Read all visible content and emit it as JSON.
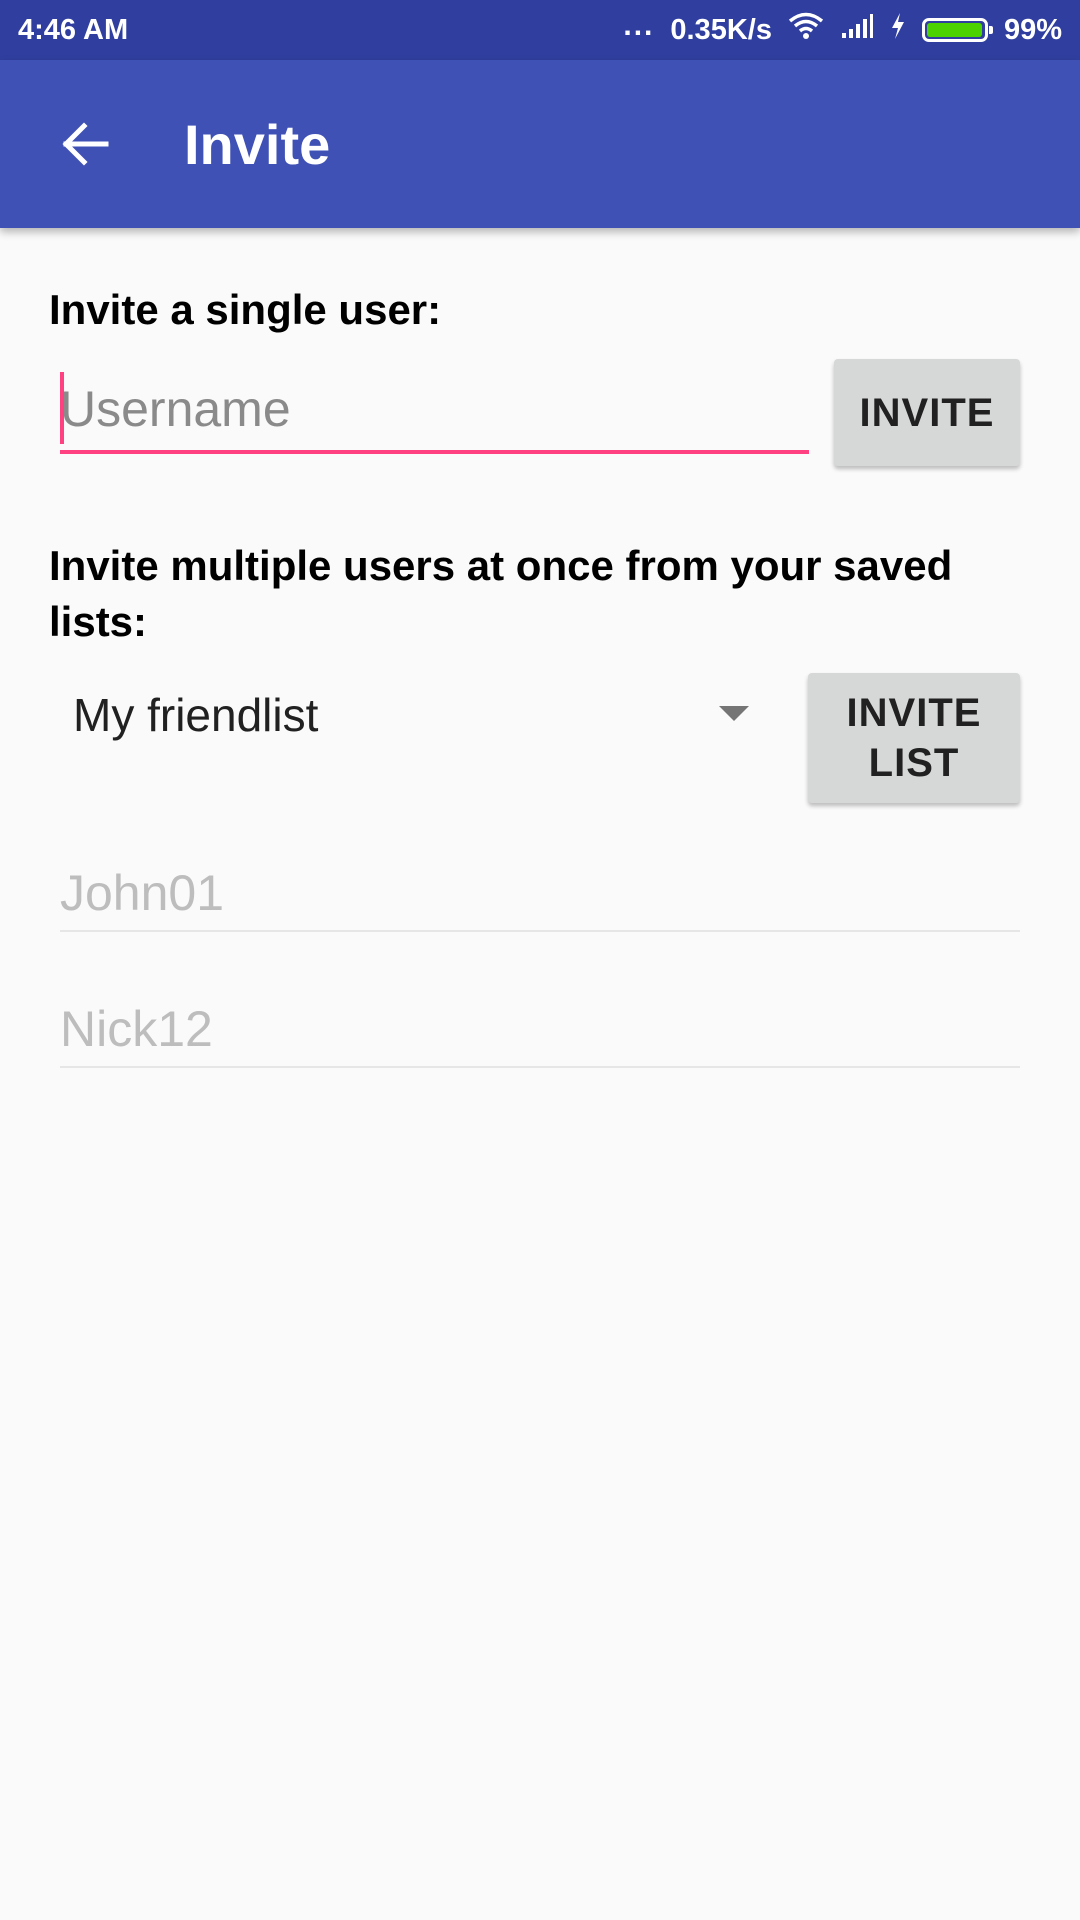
{
  "status_bar": {
    "time": "4:46 AM",
    "dots": "...",
    "network_speed": "0.35K/s",
    "battery_percent": "99%",
    "battery_level": 0.99,
    "icons": [
      "wifi-icon",
      "signal-icon",
      "charging-icon",
      "battery-icon"
    ]
  },
  "app_bar": {
    "title": "Invite",
    "back_icon": "arrow-back-icon",
    "color": "#3f51b5"
  },
  "single_invite": {
    "label": "Invite a single user:",
    "input_value": "",
    "input_placeholder": "Username",
    "button_label": "INVITE",
    "accent_color": "#ff4081"
  },
  "list_invite": {
    "label": "Invite multiple users at once from your saved lists:",
    "selected_list": "My friendlist",
    "button_label_line1": "INVITE",
    "button_label_line2": "LIST",
    "members": [
      "John01",
      "Nick12"
    ]
  }
}
